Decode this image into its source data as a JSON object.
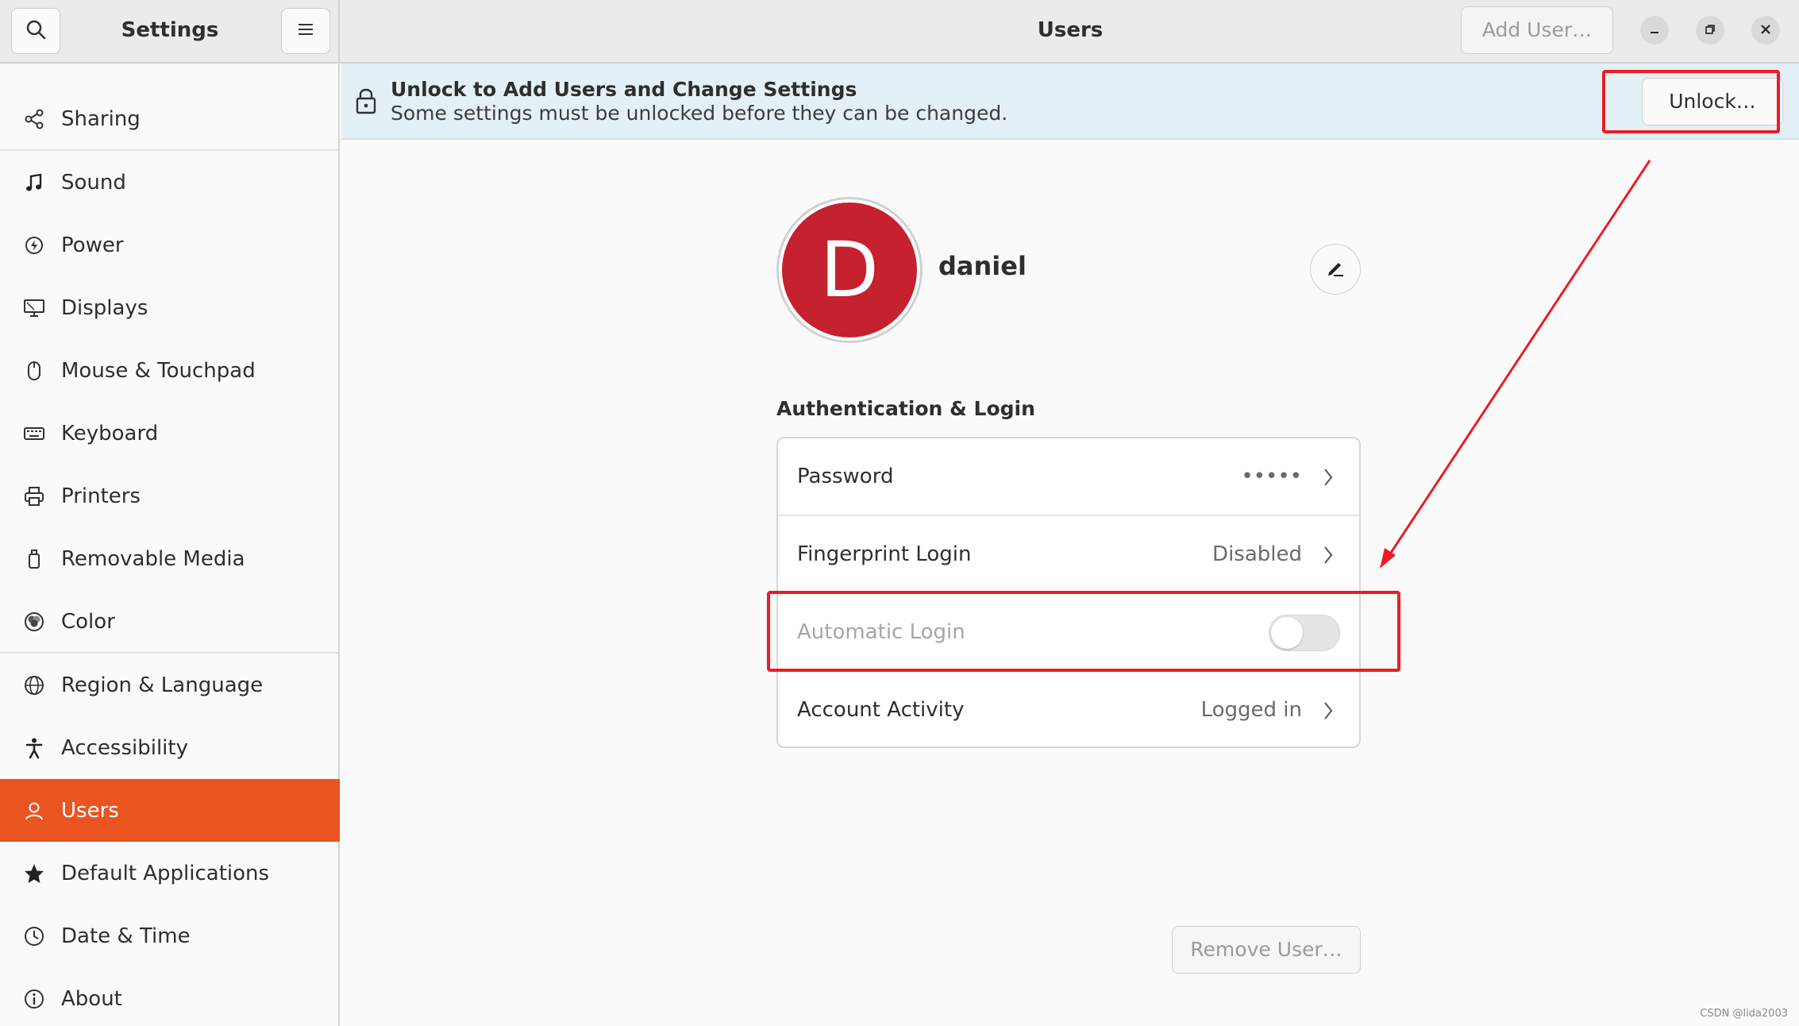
{
  "header": {
    "search_icon": "search-icon",
    "menu_icon": "hamburger-menu-icon",
    "sidebar_title": "Settings",
    "page_title": "Users",
    "add_user_label": "Add User…"
  },
  "window_controls": [
    "minimize-icon",
    "restore-icon",
    "close-icon"
  ],
  "sidebar": {
    "items": [
      {
        "label": "Sharing",
        "icon": "share-icon"
      },
      {
        "label": "Sound",
        "icon": "music-note-icon"
      },
      {
        "label": "Power",
        "icon": "power-icon"
      },
      {
        "label": "Displays",
        "icon": "display-icon"
      },
      {
        "label": "Mouse & Touchpad",
        "icon": "mouse-icon"
      },
      {
        "label": "Keyboard",
        "icon": "keyboard-icon"
      },
      {
        "label": "Printers",
        "icon": "printer-icon"
      },
      {
        "label": "Removable Media",
        "icon": "removable-media-icon"
      },
      {
        "label": "Color",
        "icon": "color-icon"
      },
      {
        "label": "Region & Language",
        "icon": "globe-icon"
      },
      {
        "label": "Accessibility",
        "icon": "accessibility-icon"
      },
      {
        "label": "Users",
        "icon": "users-icon",
        "active": true
      },
      {
        "label": "Default Applications",
        "icon": "star-icon"
      },
      {
        "label": "Date & Time",
        "icon": "clock-icon"
      },
      {
        "label": "About",
        "icon": "info-icon"
      }
    ],
    "active_color": "#e95420"
  },
  "banner": {
    "title": "Unlock to Add Users and Change Settings",
    "subtitle": "Some settings must be unlocked before they can be changed.",
    "unlock_label": "Unlock…"
  },
  "user": {
    "avatar_letter": "D",
    "avatar_color": "#c6212e",
    "name": "daniel"
  },
  "auth": {
    "section_title": "Authentication & Login",
    "rows": [
      {
        "label": "Password",
        "value": "•••••",
        "type": "link"
      },
      {
        "label": "Fingerprint Login",
        "value": "Disabled",
        "type": "link"
      },
      {
        "label": "Automatic Login",
        "value": "",
        "type": "toggle",
        "enabled": false,
        "disabled": true
      },
      {
        "label": "Account Activity",
        "value": "Logged in",
        "type": "link"
      }
    ]
  },
  "remove_user_label": "Remove User…",
  "annotation_color": "#ee1b24",
  "watermark": "CSDN @lida2003"
}
